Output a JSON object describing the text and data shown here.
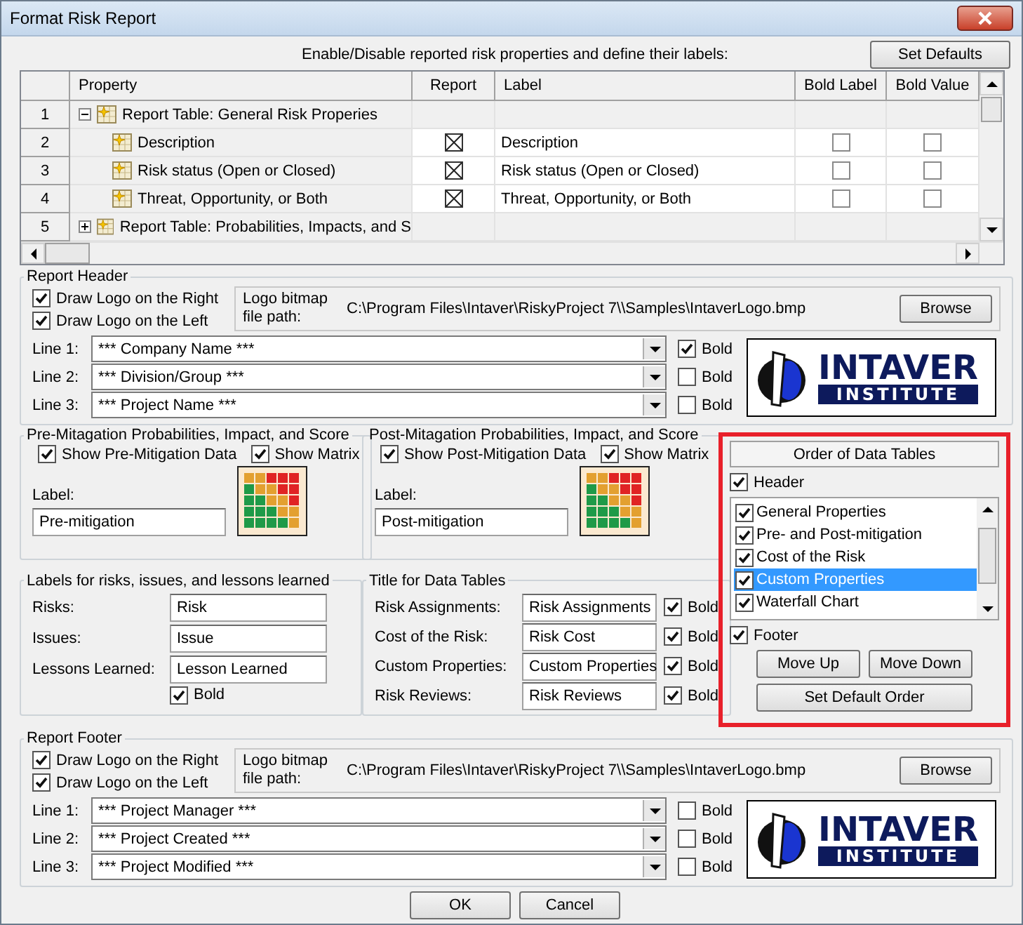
{
  "window": {
    "title": "Format Risk Report"
  },
  "properties": {
    "instruction": "Enable/Disable reported risk properties and define their labels:",
    "set_defaults_button": "Set Defaults",
    "columns": [
      "Property",
      "Report",
      "Label",
      "Bold Label",
      "Bold Value"
    ],
    "rows": [
      {
        "number": "1",
        "kind": "group",
        "expanded": true,
        "property": "Report Table: General Risk Properies"
      },
      {
        "number": "2",
        "kind": "property",
        "property": "Description",
        "report": true,
        "label": "Description",
        "bold_label": false,
        "bold_value": false
      },
      {
        "number": "3",
        "kind": "property",
        "property": "Risk status (Open or Closed)",
        "report": true,
        "label": "Risk status (Open or Closed)",
        "bold_label": false,
        "bold_value": false
      },
      {
        "number": "4",
        "kind": "property",
        "property": "Threat, Opportunity, or Both",
        "report": true,
        "label": "Threat, Opportunity, or Both",
        "bold_label": false,
        "bold_value": false
      },
      {
        "number": "5",
        "kind": "group",
        "expanded": false,
        "property": "Report Table: Probabilities, Impacts, and S"
      }
    ]
  },
  "report_header": {
    "title": "Report Header",
    "logo_options": [
      {
        "label": "Draw Logo on the Right",
        "checked": true
      },
      {
        "label": "Draw Logo on the Left",
        "checked": true
      }
    ],
    "path_caption": "Logo bitmap file path:",
    "path": "C:\\Program Files\\Intaver\\RiskyProject 7\\\\Samples\\IntaverLogo.bmp",
    "browse_button": "Browse",
    "lines": [
      {
        "label": "Line 1:",
        "value": "*** Company Name ***",
        "bold_caption": "Bold",
        "bold": true
      },
      {
        "label": "Line 2:",
        "value": "*** Division/Group ***",
        "bold_caption": "Bold",
        "bold": false
      },
      {
        "label": "Line 3:",
        "value": "*** Project Name ***",
        "bold_caption": "Bold",
        "bold": false
      }
    ],
    "logo": {
      "name": "INTAVER",
      "subtitle": "INSTITUTE"
    }
  },
  "mitigation": [
    {
      "title": "Pre-Mitagation Probabilities, Impact, and Score",
      "options": [
        {
          "label": "Show Pre-Mitigation Data",
          "checked": true
        },
        {
          "label": "Show Matrix",
          "checked": true
        }
      ],
      "label_caption": "Label:",
      "label_value": "Pre-mitigation"
    },
    {
      "title": "Post-Mitagation Probabilities, Impact, and Score",
      "options": [
        {
          "label": "Show Post-Mitigation Data",
          "checked": true
        },
        {
          "label": "Show Matrix",
          "checked": true
        }
      ],
      "label_caption": "Label:",
      "label_value": "Post-mitigation"
    }
  ],
  "labels": {
    "title": "Labels for risks, issues, and lessons learned",
    "fields": [
      {
        "label": "Risks:",
        "value": "Risk"
      },
      {
        "label": "Issues:",
        "value": "Issue"
      },
      {
        "label": "Lessons Learned:",
        "value": "Lesson Learned"
      }
    ],
    "bold": {
      "label": "Bold",
      "checked": true
    }
  },
  "table_titles": {
    "title": "Title for Data Tables",
    "rows": [
      {
        "label": "Risk Assignments:",
        "value": "Risk Assignments",
        "bold_caption": "Bold",
        "bold": true
      },
      {
        "label": "Cost of the Risk:",
        "value": "Risk Cost",
        "bold_caption": "Bold",
        "bold": true
      },
      {
        "label": "Custom Properties:",
        "value": "Custom Properties",
        "bold_caption": "Bold",
        "bold": true
      },
      {
        "label": "Risk Reviews:",
        "value": "Risk Reviews",
        "bold_caption": "Bold",
        "bold": true
      }
    ]
  },
  "order": {
    "title": "Order of Data Tables",
    "header": {
      "label": "Header",
      "checked": true
    },
    "items": [
      {
        "label": "General Properties",
        "checked": true,
        "selected": false
      },
      {
        "label": "Pre- and Post-mitigation",
        "checked": true,
        "selected": false
      },
      {
        "label": "Cost of the Risk",
        "checked": true,
        "selected": false
      },
      {
        "label": "Custom Properties",
        "checked": true,
        "selected": true
      },
      {
        "label": "Waterfall Chart",
        "checked": true,
        "selected": false
      }
    ],
    "footer": {
      "label": "Footer",
      "checked": true
    },
    "move_up_button": "Move Up",
    "move_down_button": "Move Down",
    "default_order_button": "Set Default Order"
  },
  "report_footer": {
    "title": "Report Footer",
    "logo_options": [
      {
        "label": "Draw Logo on the Right",
        "checked": true
      },
      {
        "label": "Draw Logo on the Left",
        "checked": true
      }
    ],
    "path_caption": "Logo bitmap file path:",
    "path": "C:\\Program Files\\Intaver\\RiskyProject 7\\\\Samples\\IntaverLogo.bmp",
    "browse_button": "Browse",
    "lines": [
      {
        "label": "Line 1:",
        "value": "*** Project Manager ***",
        "bold_caption": "Bold",
        "bold": false
      },
      {
        "label": "Line 2:",
        "value": "*** Project Created ***",
        "bold_caption": "Bold",
        "bold": false
      },
      {
        "label": "Line 3:",
        "value": "*** Project Modified ***",
        "bold_caption": "Bold",
        "bold": false
      }
    ],
    "logo": {
      "name": "INTAVER",
      "subtitle": "INSTITUTE"
    }
  },
  "buttons": [
    "OK",
    "Cancel"
  ]
}
